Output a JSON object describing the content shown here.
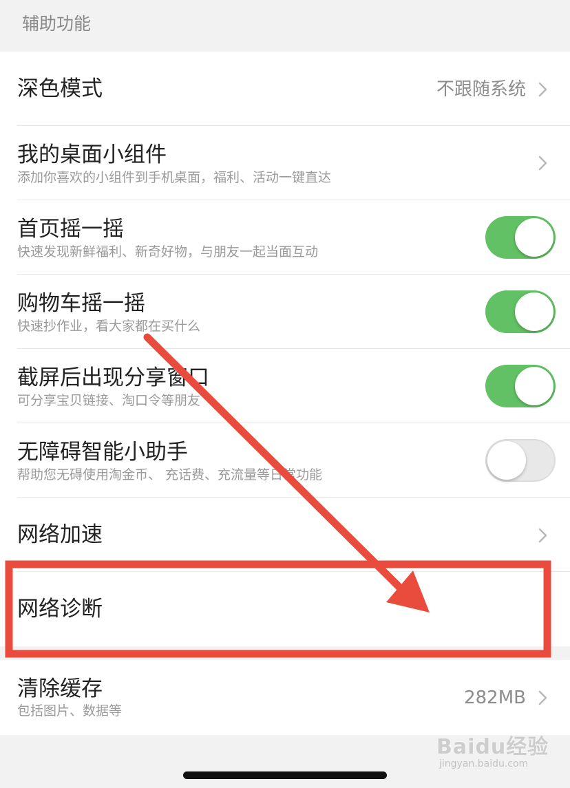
{
  "section": {
    "title": "辅助功能"
  },
  "rows": {
    "dark_mode": {
      "title": "深色模式",
      "value": "不跟随系统"
    },
    "widgets": {
      "title": "我的桌面小组件",
      "subtitle": "添加你喜欢的小组件到手机桌面，福利、活动一键直达"
    },
    "home_shake": {
      "title": "首页摇一摇",
      "subtitle": "快速发现新鲜福利、新奇好物，与朋友一起当面互动",
      "on": true
    },
    "cart_shake": {
      "title": "购物车摇一摇",
      "subtitle": "快速抄作业，看大家都在买什么",
      "on": true
    },
    "screenshot_share": {
      "title": "截屏后出现分享窗口",
      "subtitle": "可分享宝贝链接、淘口令等朋友",
      "on": true
    },
    "accessibility_assistant": {
      "title": "无障碍智能小助手",
      "subtitle": "帮助您无碍使用淘金币、 充话费、充流量等日常功能",
      "on": false
    },
    "network_speedup": {
      "title": "网络加速"
    },
    "network_diagnosis": {
      "title": "网络诊断"
    },
    "clear_cache": {
      "title": "清除缓存",
      "subtitle": "包括图片、数据等",
      "value": "282MB"
    }
  },
  "watermark": {
    "text": "Baidu经验",
    "sub": "jingyan.baidu.com"
  },
  "colors": {
    "toggle_on": "#62c164",
    "annotation_red": "#e94b3c",
    "background": "#f2f2f2"
  },
  "icons": {
    "chevron": "chevron-right-icon"
  }
}
